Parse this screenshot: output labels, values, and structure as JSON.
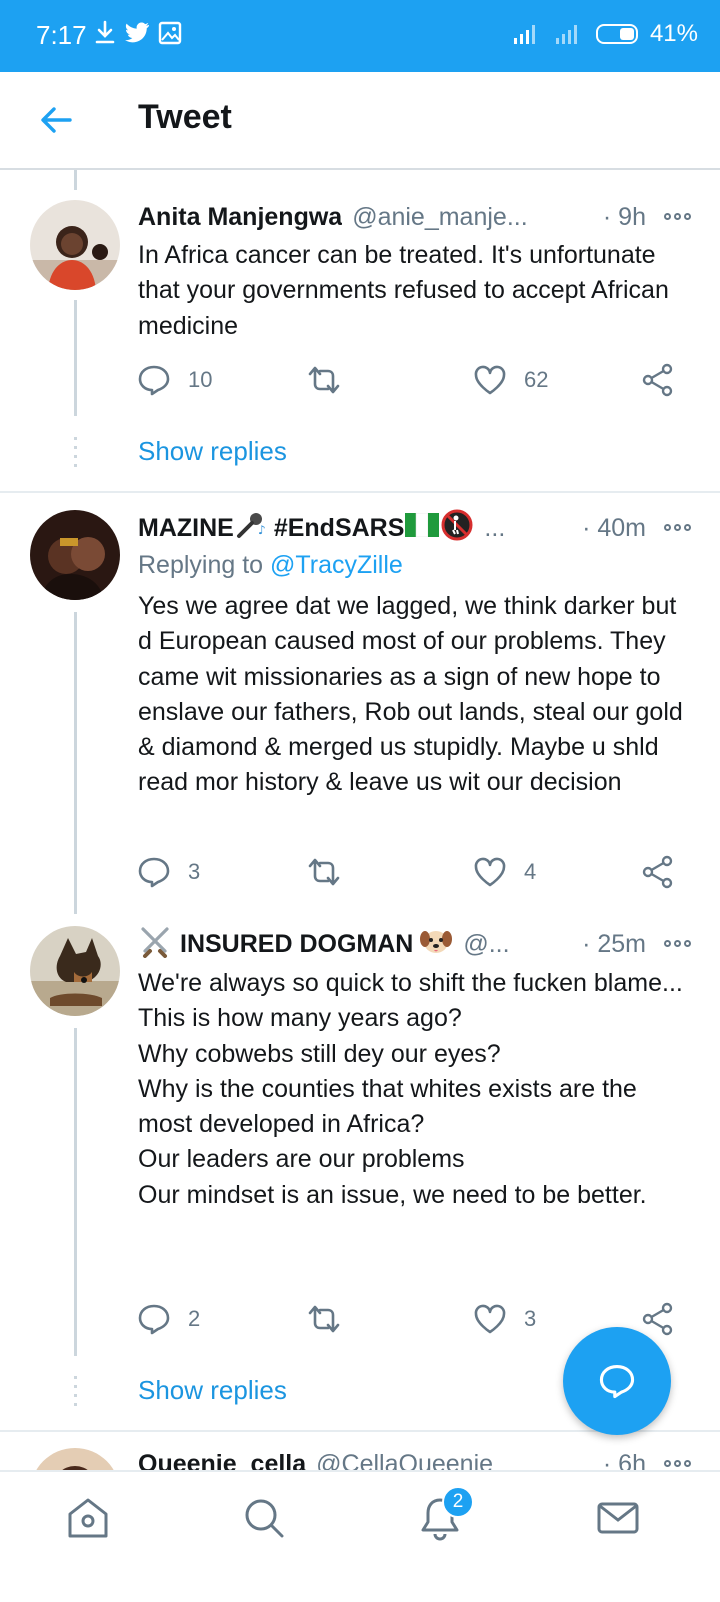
{
  "status_bar": {
    "time": "7:17",
    "battery": "41%"
  },
  "header": {
    "title": "Tweet"
  },
  "tweets": [
    {
      "name": "Anita Manjengwa",
      "handle": "@anie_manje...",
      "time": "· 9h",
      "text": "In Africa cancer can be treated. It's unfortunate that your governments refused to accept African medicine",
      "replies": "10",
      "retweets": "",
      "likes": "62",
      "show_replies": "Show replies"
    },
    {
      "name": "MAZINE",
      "name_suffix": "#EndSARS",
      "handle": "...",
      "time": "· 40m",
      "replying_to_prefix": "Replying to",
      "replying_to_handle": "@TracyZille",
      "text": "Yes we agree dat we lagged, we think darker but d European caused most of our problems. They came wit missionaries as a sign of new hope to enslave our fathers, Rob out lands, steal our gold & diamond & merged us stupidly. Maybe u shld read mor history & leave us wit our decision",
      "replies": "3",
      "retweets": "",
      "likes": "4"
    },
    {
      "name": "INSURED DOGMAN",
      "handle": "@...",
      "time": "· 25m",
      "text": "We're always so quick to shift the fucken blame...\nThis is how many years ago?\nWhy cobwebs still dey our eyes?\nWhy is the counties that whites exists are the most developed in Africa?\nOur leaders are our problems\nOur mindset is an issue, we need to be better.",
      "replies": "2",
      "retweets": "",
      "likes": "3",
      "show_replies": "Show replies"
    },
    {
      "name": "Queenie_cella",
      "handle": "@CellaQueenie",
      "time": "· 6h"
    }
  ],
  "bottom_nav": {
    "notifications_badge": "2"
  },
  "colors": {
    "accent": "#1da1f2",
    "text": "#14171a",
    "secondary": "#657786"
  }
}
